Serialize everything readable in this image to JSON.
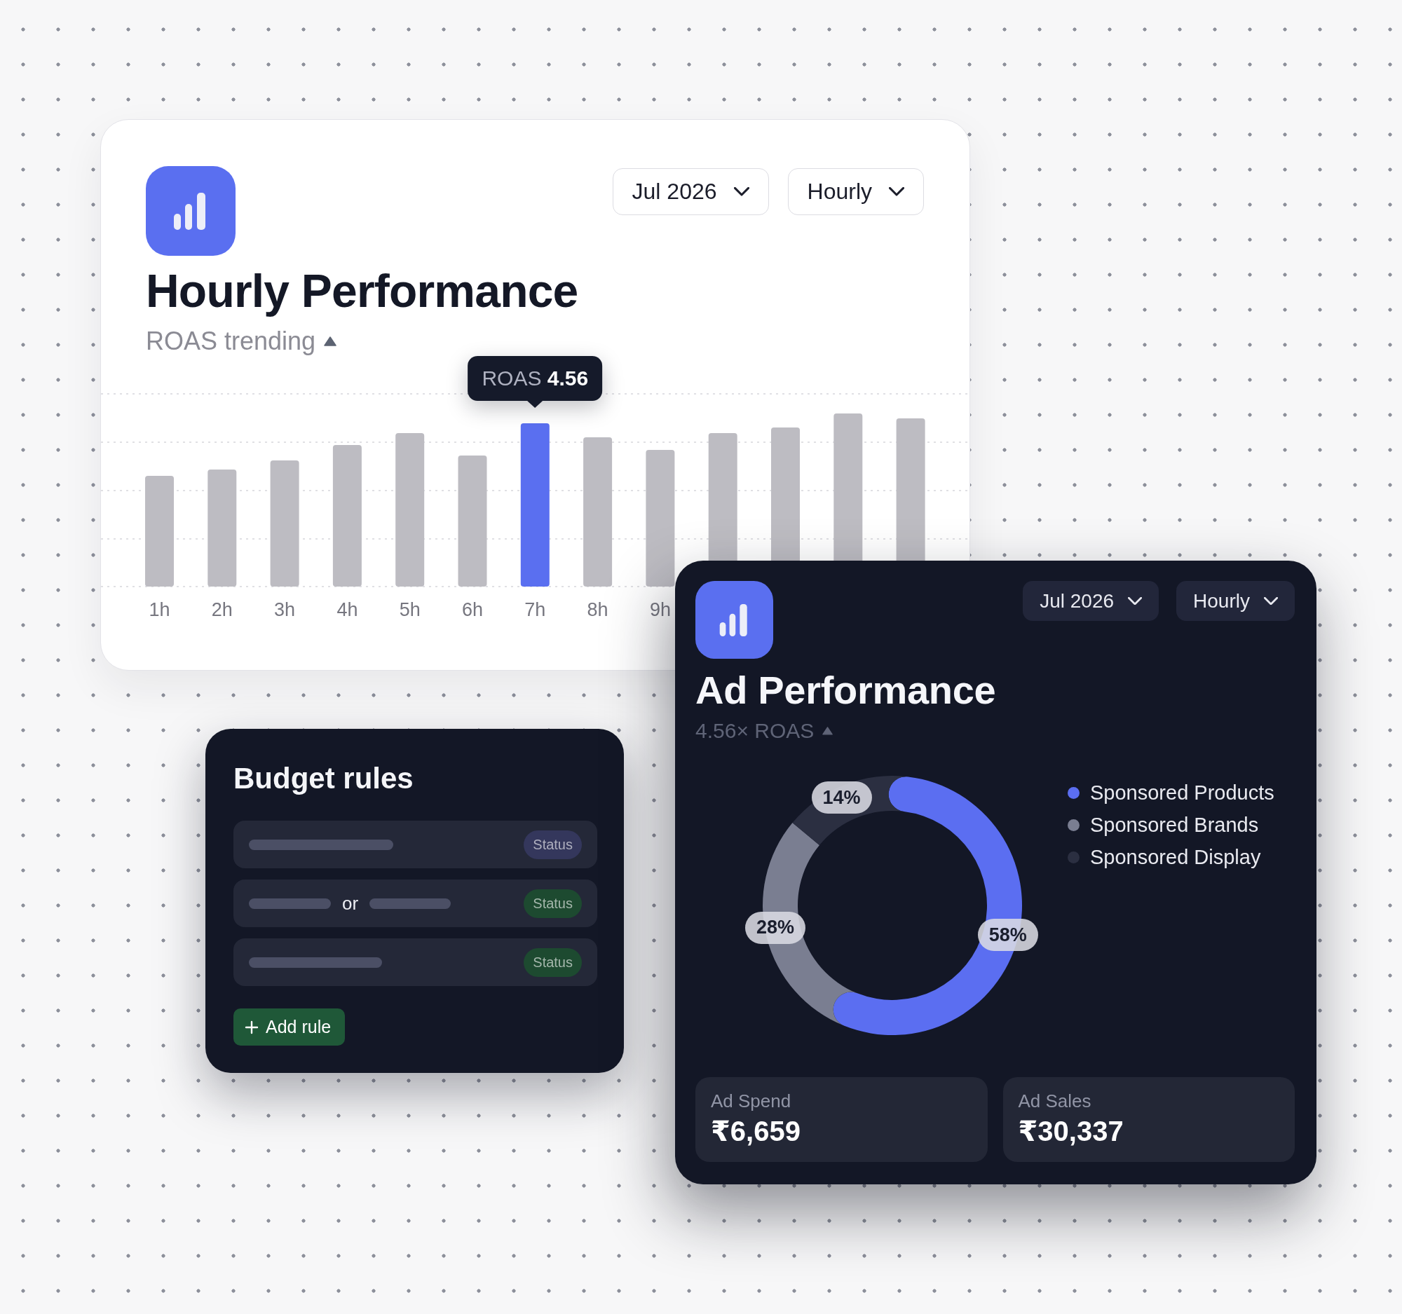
{
  "hourly_card": {
    "title": "Hourly Performance",
    "subtitle": "ROAS trending",
    "dropdowns": [
      "Jul 2026",
      "Hourly"
    ],
    "tooltip": "ROAS **4.56**",
    "bars": [
      {
        "label": "1h",
        "selected": false
      },
      {
        "label": "2h",
        "selected": false
      },
      {
        "label": "3h",
        "selected": false
      },
      {
        "label": "4h",
        "selected": false
      },
      {
        "label": "5h",
        "selected": false
      },
      {
        "label": "6h",
        "selected": false
      },
      {
        "label": "7h",
        "selected": true
      },
      {
        "label": "8h",
        "selected": false
      },
      {
        "label": "9h",
        "selected": false
      },
      {
        "selected": false
      },
      {
        "selected": false
      },
      {
        "selected": false
      },
      {
        "selected": false
      }
    ]
  },
  "budget_card": {
    "title": "Budget rules",
    "rules": [
      {
        "kind": "single",
        "status": "Status",
        "color": "#34375c"
      },
      {
        "kind": "either",
        "connector": "or",
        "status": "Status",
        "color": "#1d4a30"
      },
      {
        "kind": "single",
        "status": "Status",
        "color": "#1d4a30"
      }
    ],
    "add_button": "Add rule"
  },
  "ad_card": {
    "title": "Ad Performance",
    "subtitle": "4.56× ROAS",
    "dropdowns": [
      "Jul 2026",
      "Hourly"
    ],
    "chart_data": {
      "type": "donut",
      "categories": [
        "Sponsored Products",
        "Sponsored Brands",
        "Sponsored Display"
      ],
      "values": [
        58,
        28,
        14
      ],
      "value_labels": [
        "58%",
        "28%",
        "14%"
      ]
    },
    "legend": [
      {
        "color": "#5b6ef1"
      },
      {
        "color": "#7a7e91"
      },
      {
        "color": "#2b2f41"
      }
    ],
    "stats": [
      {
        "label": "Ad Spend",
        "value": "₹6,659"
      },
      {
        "label": "Ad Sales",
        "value": "₹30,337"
      }
    ]
  }
}
